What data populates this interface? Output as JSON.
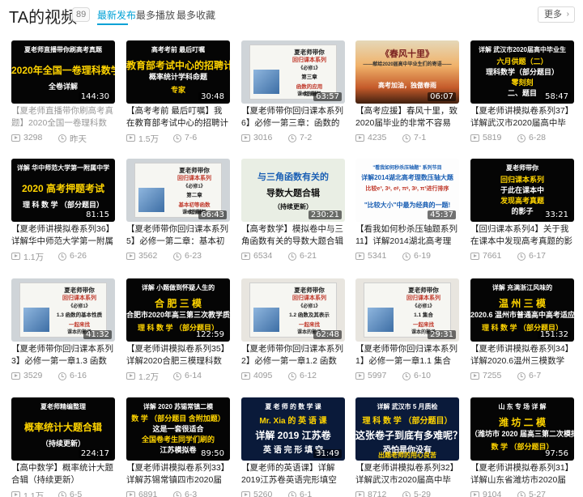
{
  "header": {
    "title": "TA的视频",
    "count": "89",
    "tabs": [
      "最新发布",
      "最多播放",
      "最多收藏"
    ],
    "more_label": "更多"
  },
  "videos": [
    {
      "thumb": [
        "夏老师直播带你刷高考真题",
        "2020年全国一卷理科数学",
        "全卷详解"
      ],
      "duration": "144:30",
      "title": "【夏老师直播带你刷高考真题】2020全国一卷理科数学",
      "plays": "3298",
      "date": "昨天",
      "faded": true
    },
    {
      "thumb": [
        "高考考前 最后叮嘱",
        "教育部考试中心的招聘计划中发现",
        "概率统计学科命题",
        "专家"
      ],
      "duration": "30:48",
      "title": "【高考考前 最后叮嘱】我在教育部考试中心的招聘计划中发",
      "plays": "1.5万",
      "date": "7-6"
    },
    {
      "thumb": [
        "夏老师带你",
        "回归课本系列",
        "《必修1》",
        "第三章",
        "函数的应用",
        "一起来找",
        "课本的影子"
      ],
      "duration": "63:57",
      "title": "【夏老师带你回归课本系列6】必修一第三章：函数的应",
      "plays": "3016",
      "date": "7-2"
    },
    {
      "thumb": [
        "《春风十里》",
        "——献给2020届高中毕业生们的寄语——",
        "高考加油，独傲春雨"
      ],
      "duration": "06:07",
      "title": "【高考应援】春风十里，致2020届毕业的非常不容易的",
      "plays": "4235",
      "date": "7-1"
    },
    {
      "thumb": [
        "详解 武汉市2020届高中毕业生",
        "六月供题（二）",
        "理科数学（部分题目）",
        "零刻刻",
        "二、题目"
      ],
      "duration": "58:47",
      "title": "【夏老师讲模拟卷系列37】详解武汉市2020届高中毕业生",
      "plays": "5819",
      "date": "6-28"
    },
    {
      "thumb": [
        "详解 华中师范大学第一附属中学",
        "2020 高考押题考试",
        "理 科 数 学 （部分题目）"
      ],
      "duration": "81:15",
      "title": "【夏老师讲模拟卷系列36】详解华中师范大学第一附属中学",
      "plays": "1.1万",
      "date": "6-26"
    },
    {
      "thumb": [
        "夏老师带你",
        "回归课本系列",
        "《必修1》",
        "第二章",
        "基本初等函数",
        "一起来找",
        "课本的影子"
      ],
      "duration": "66:43",
      "title": "【夏老师带你回归课本系列5】必修一第二章：基本初等",
      "plays": "3562",
      "date": "6-23"
    },
    {
      "thumb": [
        "与三角函数有关的",
        "导数大题合辑",
        "（持续更新）"
      ],
      "duration": "230:21",
      "title": "【高考数学】模拟卷中与三角函数有关的导数大题合辑（持",
      "plays": "6534",
      "date": "6-21"
    },
    {
      "thumb": [
        "\"看我如何秒杀压轴题\" 系列节目",
        "详解2014湖北高考理数压轴大题",
        "比较e³, 3ᵉ, eᵖ, πᵉ, 3ᵖ, π³进行排序",
        "\"比较大小\"中最为经典的一题!"
      ],
      "duration": "45:37",
      "title": "【看我如何秒杀压轴题系列11】详解2014湖北高考理数压轴",
      "plays": "5341",
      "date": "6-19"
    },
    {
      "thumb": [
        "夏老师带你",
        "回归课本系列",
        "于此在课本中",
        "发现高考真题",
        "的影子"
      ],
      "duration": "33:21",
      "title": "【回归课本系列4】关于我在课本中发现高考真题的影子这",
      "plays": "7661",
      "date": "6-17"
    },
    {
      "thumb": [
        "夏老师带你",
        "回归课本系列",
        "《必修1》",
        "1.3 函数的基本性质",
        "一起来找",
        "课本的影子"
      ],
      "duration": "41:32",
      "title": "【夏老师带你回归课本系列3】必修一第一章1.3 函数的基",
      "plays": "3529",
      "date": "6-16"
    },
    {
      "thumb": [
        "详解 小题做到怀疑人生的",
        "合 肥 三 模",
        "合肥市2020年高三第三次教学质量检测",
        "理 科 数 学 （部分题目）"
      ],
      "duration": "122:59",
      "title": "【夏老师讲模拟卷系列35】详解2020合肥三模理科数学",
      "plays": "1.2万",
      "date": "6-14"
    },
    {
      "thumb": [
        "夏老师带你",
        "回归课本系列",
        "《必修1》",
        "1.2 函数及其表示",
        "一起来找",
        "课本的影子"
      ],
      "duration": "62:48",
      "title": "【夏老师带你回归课本系列2】必修一第一章1.2 函数及其",
      "plays": "4095",
      "date": "6-12"
    },
    {
      "thumb": [
        "夏老师带你",
        "回归课本系列",
        "《必修1》",
        "1.1 集合",
        "一起来找",
        "课本的影子"
      ],
      "duration": "29:31",
      "title": "【夏老师带你回归课本系列1】必修一第一章1.1 集合",
      "plays": "5997",
      "date": "6-10"
    },
    {
      "thumb": [
        "详解 充满浙江风味的",
        "温 州 三 模",
        "2020.6 温州市普通高中高考适应性测试",
        "理 科 数 学 （部分题目）"
      ],
      "duration": "151:32",
      "title": "【夏老师讲模拟卷系列34】详解2020.6温州三模数学（部分",
      "plays": "7255",
      "date": "6-7"
    },
    {
      "thumb": [
        "夏老师精编整理",
        "概率统计大题合辑",
        "（持续更新）"
      ],
      "duration": "224:17",
      "title": "【高中数学】概率统计大题合辑（持续更新）",
      "plays": "1.1万",
      "date": "6-5"
    },
    {
      "thumb": [
        "详解 2020 苏锡常镇二模",
        "数 学 （部分题目 含附加题）",
        "这是一套很适合",
        "全国卷考生同学们刷的",
        "江苏模拟卷"
      ],
      "duration": "89:50",
      "title": "【夏老师讲模拟卷系列33】详解苏锡常镇四市2020届高三",
      "plays": "6891",
      "date": "6-3"
    },
    {
      "thumb": [
        "夏 老 师 的 数 学 课",
        "Mr. Xia 的 英 语 课",
        "详解 2019 江苏卷",
        "英 语 完 形 填 空"
      ],
      "duration": "31:49",
      "title": "【夏老师的英语课】详解2019江苏卷英语完形填空",
      "plays": "5260",
      "date": "6-1"
    },
    {
      "thumb": [
        "详解 武汉市 5 月质检",
        "理 科 数 学 （部分题目）",
        "这张卷子到底有多难呢？",
        "恐怕是你没有",
        "出题老师的用心良苦"
      ],
      "duration": "",
      "title": "【夏老师讲模拟卷系列32】详解武汉市2020届高中毕业生",
      "plays": "8712",
      "date": "5-29"
    },
    {
      "thumb": [
        "山 东 专 场   详 解",
        "潍 坊 二 模",
        "（潍坊市 2020 届高三第二次模拟考试）",
        "数 学 （部分题目）"
      ],
      "duration": "97:56",
      "title": "【夏老师讲模拟卷系列31】详解山东省潍坊市2020届高三",
      "plays": "9104",
      "date": "5-27"
    }
  ]
}
